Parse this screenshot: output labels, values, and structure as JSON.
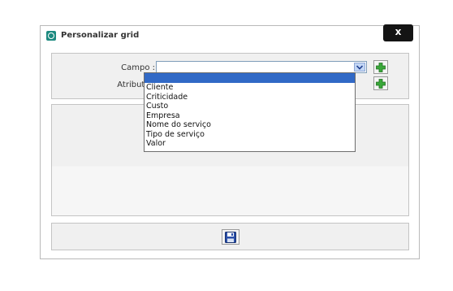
{
  "dialog": {
    "title": "Personalizar grid",
    "close_label": "x"
  },
  "form": {
    "campo_label": "Campo :",
    "atributo_label": "Atributo :",
    "campo_value": "",
    "options": [
      "",
      "Cliente",
      "Criticidade",
      "Custo",
      "Empresa",
      "Nome do serviço",
      "Tipo de serviço",
      "Valor"
    ],
    "selected_index": 0
  },
  "icons": {
    "title": "grid-app-icon",
    "dropdown_arrow": "chevron-down-icon",
    "add": "plus-icon",
    "save": "floppy-disk-icon"
  },
  "colors": {
    "close_button": "#141414",
    "selected_option": "#3169c6",
    "add_icon": "#3aa83a",
    "save_icon": "#2a4fa8"
  }
}
